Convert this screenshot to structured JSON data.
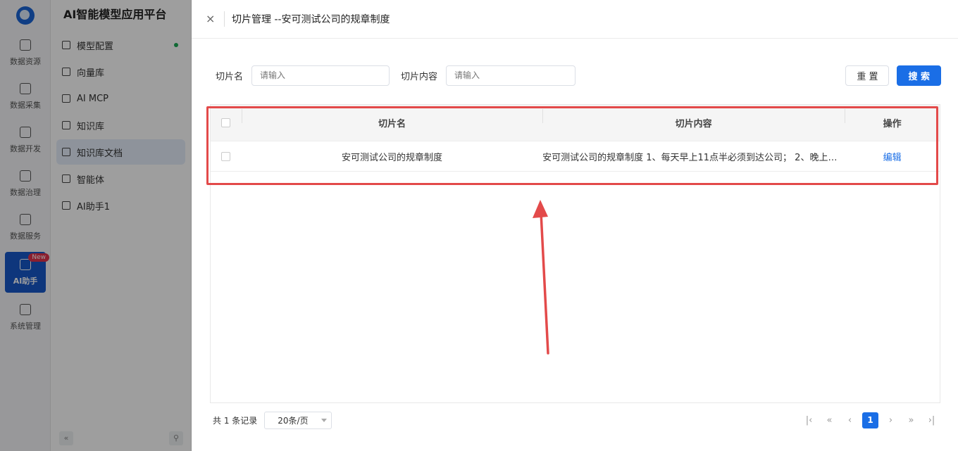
{
  "app": {
    "title": "AI智能模型应用平台"
  },
  "rail": {
    "items": [
      {
        "label": "数据资源",
        "icon": "database-icon"
      },
      {
        "label": "数据采集",
        "icon": "collect-icon"
      },
      {
        "label": "数据开发",
        "icon": "develop-icon"
      },
      {
        "label": "数据治理",
        "icon": "layers-icon"
      },
      {
        "label": "数据服务",
        "icon": "service-icon"
      },
      {
        "label": "AI助手",
        "icon": "ai-icon",
        "badge": "New",
        "active": true
      },
      {
        "label": "系统管理",
        "icon": "grid-icon"
      }
    ]
  },
  "sidebar": {
    "items": [
      {
        "label": "模型配置",
        "icon": "model-icon",
        "status_dot": true
      },
      {
        "label": "向量库",
        "icon": "vector-icon"
      },
      {
        "label": "AI MCP",
        "icon": "mcp-icon"
      },
      {
        "label": "知识库",
        "icon": "book-icon"
      },
      {
        "label": "知识库文档",
        "icon": "docs-icon",
        "active": true
      },
      {
        "label": "智能体",
        "icon": "agent-icon"
      },
      {
        "label": "AI助手1",
        "icon": "ai-badge-icon"
      }
    ],
    "collapse_glyph": "«",
    "pin_glyph": "⚲"
  },
  "drawer": {
    "close_glyph": "×",
    "title": "切片管理 --安可测试公司的规章制度"
  },
  "filters": {
    "name_label": "切片名",
    "name_placeholder": "请输入",
    "content_label": "切片内容",
    "content_placeholder": "请输入",
    "reset_label": "重 置",
    "search_label": "搜 索"
  },
  "table": {
    "headers": [
      "切片名",
      "切片内容",
      "操作"
    ],
    "rows": [
      {
        "name": "安可测试公司的规章制度",
        "content": "安可测试公司的规章制度 1、每天早上11点半必须到达公司； 2、晚上有...",
        "action": "编辑"
      }
    ]
  },
  "pagination": {
    "total_text": "共 1 条记录",
    "page_size": "20条/页",
    "current_page": "1"
  },
  "colors": {
    "primary": "#1a6ee6",
    "highlight": "#e34a4a",
    "active_rail": "#1858c8",
    "badge": "#e0334d"
  }
}
